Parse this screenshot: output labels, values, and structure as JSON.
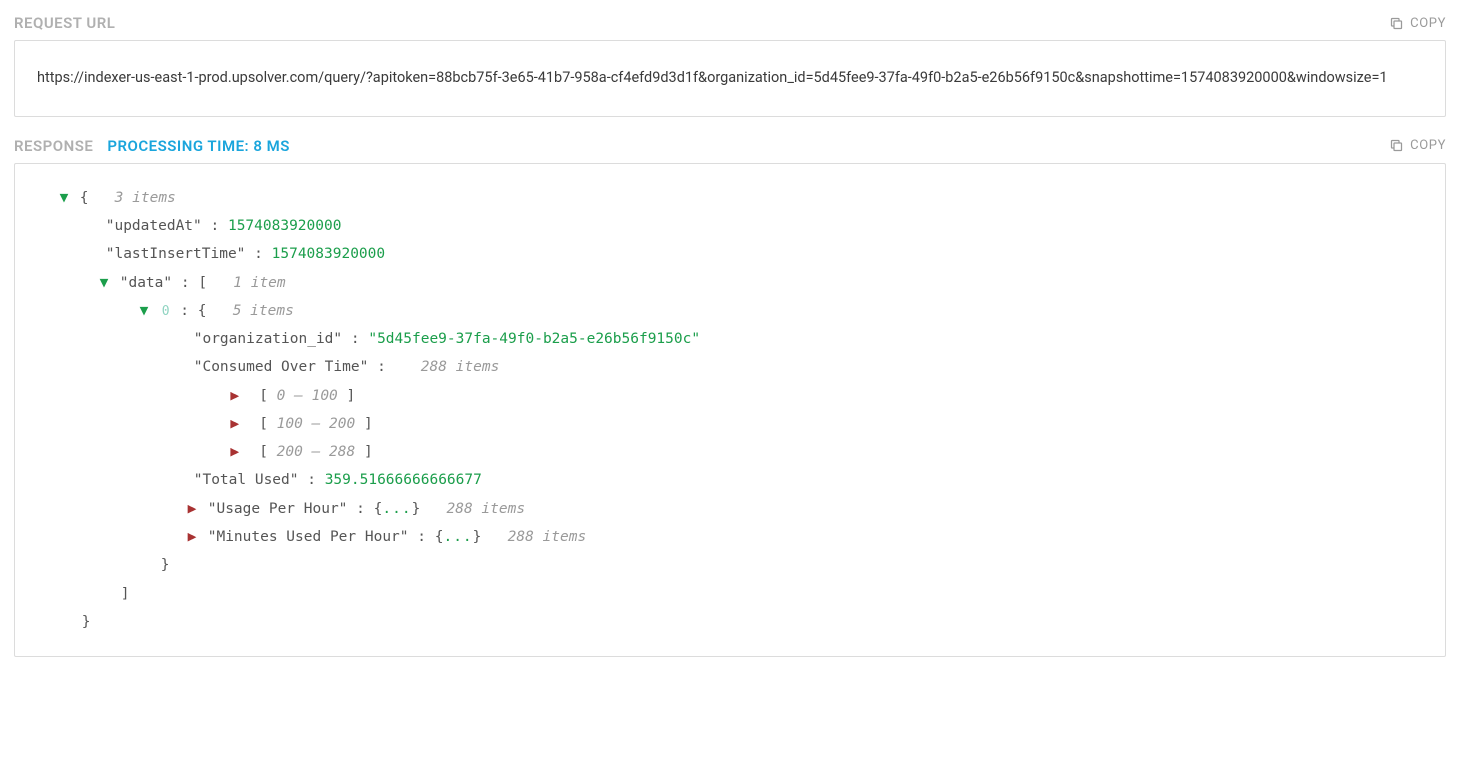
{
  "request": {
    "title": "REQUEST URL",
    "copy_label": "COPY",
    "url": "https://indexer-us-east-1-prod.upsolver.com/query/?apitoken=88bcb75f-3e65-41b7-958a-cf4efd9d3d1f&organization_id=5d45fee9-37fa-49f0-b2a5-e26b56f9150c&snapshottime=1574083920000&windowsize=1"
  },
  "response": {
    "title": "RESPONSE",
    "processing_time": "PROCESSING TIME: 8 MS",
    "copy_label": "COPY",
    "root_items": "3 items",
    "fields": {
      "updatedAt_key": "\"updatedAt\"",
      "updatedAt_val": "1574083920000",
      "lastInsertTime_key": "\"lastInsertTime\"",
      "lastInsertTime_val": "1574083920000",
      "data_key": "\"data\"",
      "data_items": "1 item",
      "data0_index": "0",
      "data0_items": "5 items",
      "org_id_key": "\"organization_id\"",
      "org_id_val": "\"5d45fee9-37fa-49f0-b2a5-e26b56f9150c\"",
      "cot_key": "\"Consumed Over Time\"",
      "cot_items": "288 items",
      "cot_r1": "0 – 100",
      "cot_r2": "100 – 200",
      "cot_r3": "200 – 288",
      "total_used_key": "\"Total Used\"",
      "total_used_val": "359.51666666666677",
      "uph_key": "\"Usage Per Hour\"",
      "uph_items": "288 items",
      "muph_key": "\"Minutes Used Per Hour\"",
      "muph_items": "288 items"
    }
  }
}
